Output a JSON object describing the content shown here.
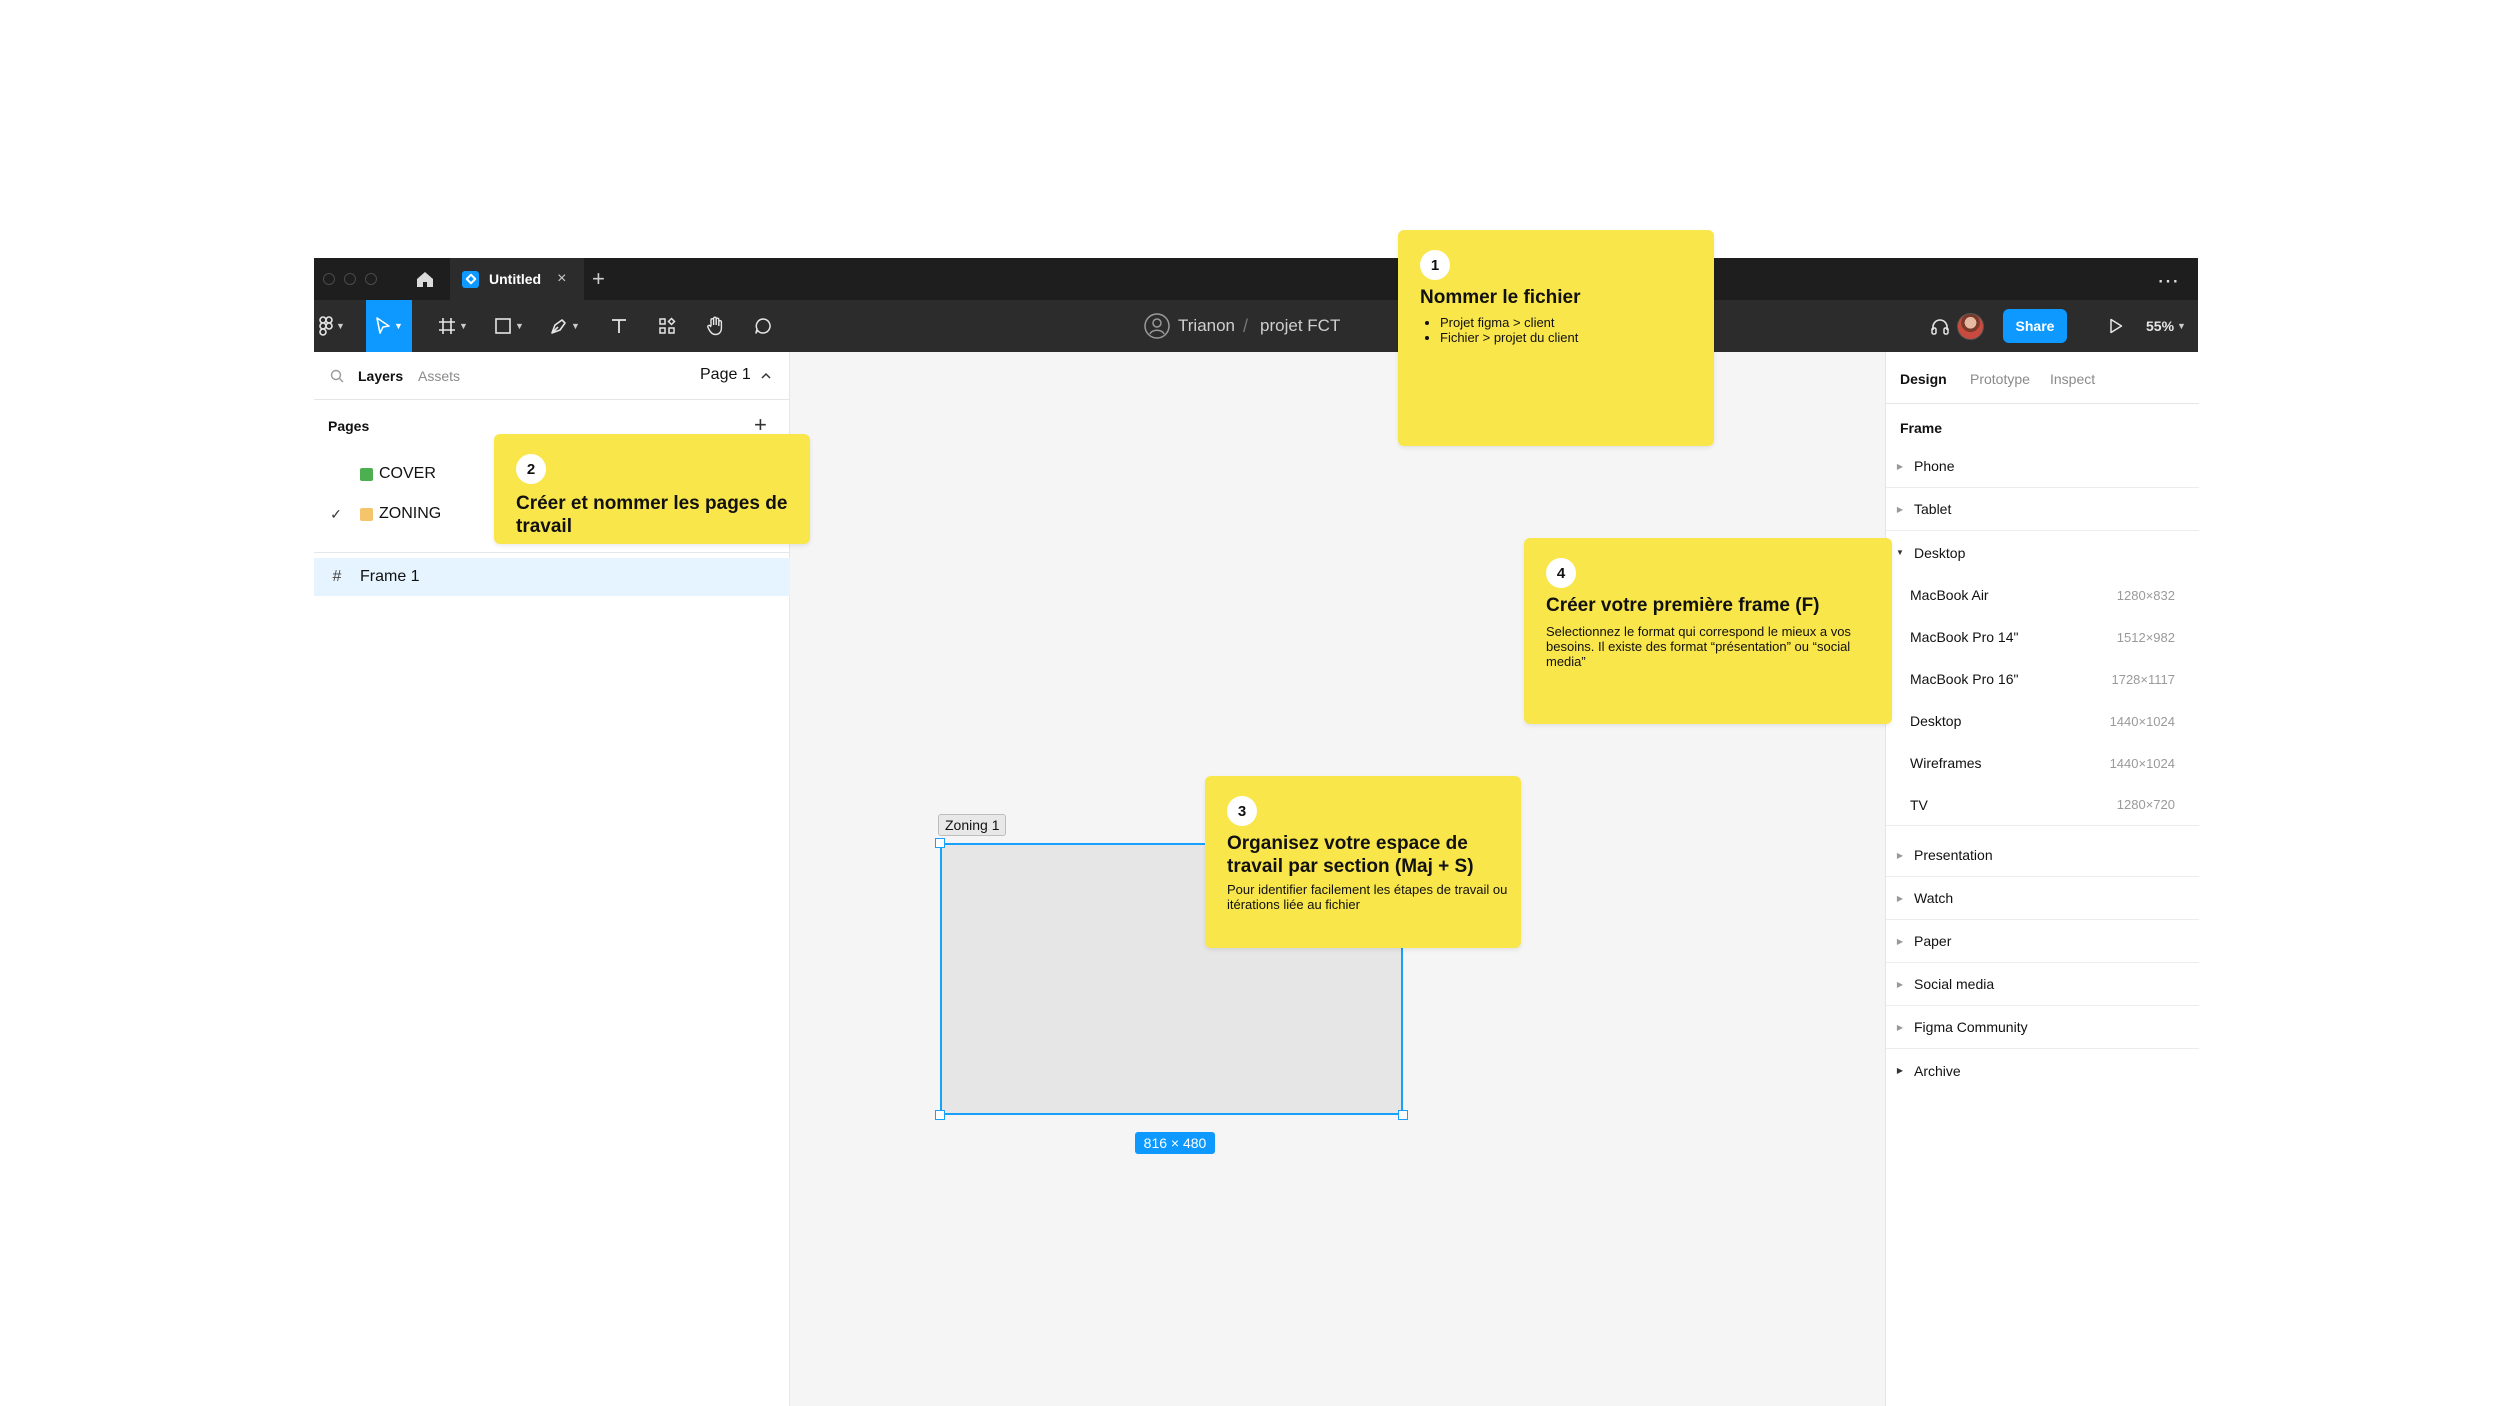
{
  "window": {
    "tab_title": "Untitled",
    "tab_close": "×",
    "new_tab": "+",
    "more": "⋯"
  },
  "toolbar": {
    "team": "Trianon",
    "separator": "/",
    "file_name": "projet FCT",
    "share_label": "Share",
    "zoom_label": "55%"
  },
  "left_panel": {
    "tabs": [
      "Layers",
      "Assets"
    ],
    "page_selector": "Page 1",
    "pages_heading": "Pages",
    "add_page": "+",
    "pages": [
      {
        "label": "COVER",
        "checked": false,
        "marker_color": "#4caf50"
      },
      {
        "label": "ZONING",
        "checked": true,
        "marker_color": "#f4c56a"
      }
    ],
    "layers": [
      {
        "label": "Frame 1"
      }
    ]
  },
  "right_panel": {
    "tabs": [
      "Design",
      "Prototype",
      "Inspect"
    ],
    "section_title": "Frame",
    "categories_top": [
      {
        "label": "Phone",
        "expanded": false
      },
      {
        "label": "Tablet",
        "expanded": false
      },
      {
        "label": "Desktop",
        "expanded": true
      }
    ],
    "presets": [
      {
        "name": "MacBook Air",
        "size": "1280×832"
      },
      {
        "name": "MacBook Pro 14\"",
        "size": "1512×982"
      },
      {
        "name": "MacBook Pro 16\"",
        "size": "1728×1117"
      },
      {
        "name": "Desktop",
        "size": "1440×1024"
      },
      {
        "name": "Wireframes",
        "size": "1440×1024"
      },
      {
        "name": "TV",
        "size": "1280×720"
      }
    ],
    "categories_bottom": [
      {
        "label": "Presentation"
      },
      {
        "label": "Watch"
      },
      {
        "label": "Paper"
      },
      {
        "label": "Social media"
      },
      {
        "label": "Figma Community"
      },
      {
        "label": "Archive"
      }
    ]
  },
  "canvas": {
    "frame_label": "Zoning 1",
    "frame_dimensions": "816 × 480"
  },
  "stickies": [
    {
      "number": "1",
      "title": "Nommer le fichier",
      "bullets": [
        "Projet figma > client",
        "Fichier > projet du client"
      ]
    },
    {
      "number": "2",
      "title": "Créer et nommer les pages de travail"
    },
    {
      "number": "3",
      "title": "Organisez votre espace de travail par section (Maj + S)",
      "body": "Pour identifier facilement les étapes de travail ou itérations liée au fichier"
    },
    {
      "number": "4",
      "title": "Créer votre première frame (F)",
      "body": "Selectionnez le format qui correspond le mieux a vos besoins. Il existe des format “présentation” ou “social media”"
    }
  ],
  "colors": {
    "accent": "#0d99ff",
    "sticky": "#f9e64b",
    "titlebar": "#1e1e1e",
    "toolbar": "#2c2c2c",
    "canvas": "#f5f5f5"
  }
}
